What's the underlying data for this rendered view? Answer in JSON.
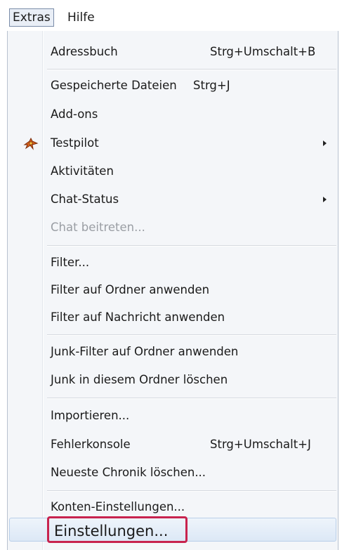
{
  "menubar": {
    "extras": "Extras",
    "hilfe": "Hilfe"
  },
  "menu": {
    "items": [
      {
        "label": "Adressbuch",
        "shortcut": "Strg+Umschalt+B"
      },
      {
        "label": "Gespeicherte Dateien",
        "shortcut": "Strg+J"
      },
      {
        "label": "Add-ons"
      },
      {
        "label": "Testpilot",
        "submenu": true,
        "icon": "testpilot-icon"
      },
      {
        "label": "Aktivitäten"
      },
      {
        "label": "Chat-Status",
        "submenu": true
      },
      {
        "label": "Chat beitreten...",
        "disabled": true
      },
      {
        "label": "Filter..."
      },
      {
        "label": "Filter auf Ordner anwenden"
      },
      {
        "label": "Filter auf Nachricht anwenden"
      },
      {
        "label": "Junk-Filter auf Ordner anwenden"
      },
      {
        "label": "Junk in diesem Ordner löschen"
      },
      {
        "label": "Importieren..."
      },
      {
        "label": "Fehlerkonsole",
        "shortcut": "Strg+Umschalt+J"
      },
      {
        "label": "Neueste Chronik löschen..."
      },
      {
        "label": "Konten-Einstellungen..."
      },
      {
        "label": "Einstellungen...",
        "highlighted": true
      }
    ]
  },
  "colors": {
    "highlight_border": "#c8234e",
    "hover_background": "#dce8f6",
    "disabled_text": "#9a9ea4"
  }
}
